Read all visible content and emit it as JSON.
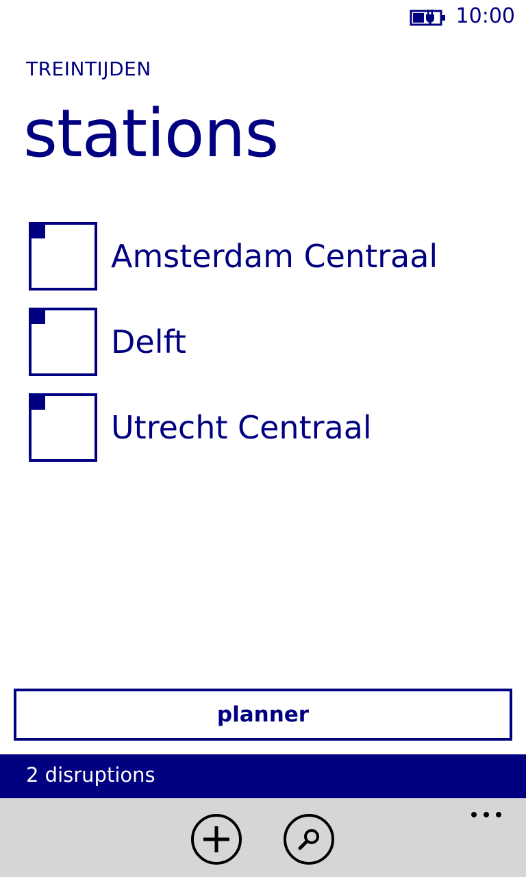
{
  "status_bar": {
    "battery_icon": "battery-charging-icon",
    "time": "10:00"
  },
  "header": {
    "app_title": "TREINTIJDEN",
    "page_title": "stations"
  },
  "stations": [
    {
      "name": "Amsterdam Centraal",
      "icon": "station-tile-icon"
    },
    {
      "name": "Delft",
      "icon": "station-tile-icon"
    },
    {
      "name": "Utrecht Centraal",
      "icon": "station-tile-icon"
    }
  ],
  "planner_button": {
    "label": "planner"
  },
  "disruptions": {
    "text": "2 disruptions"
  },
  "app_bar": {
    "buttons": [
      {
        "icon": "add-icon"
      },
      {
        "icon": "search-icon"
      }
    ],
    "more_icon": "ellipsis-icon"
  },
  "colors": {
    "accent": "#000080",
    "background": "#ffffff",
    "app_bar": "#d6d6d6",
    "text_on_accent": "#ffffff"
  }
}
